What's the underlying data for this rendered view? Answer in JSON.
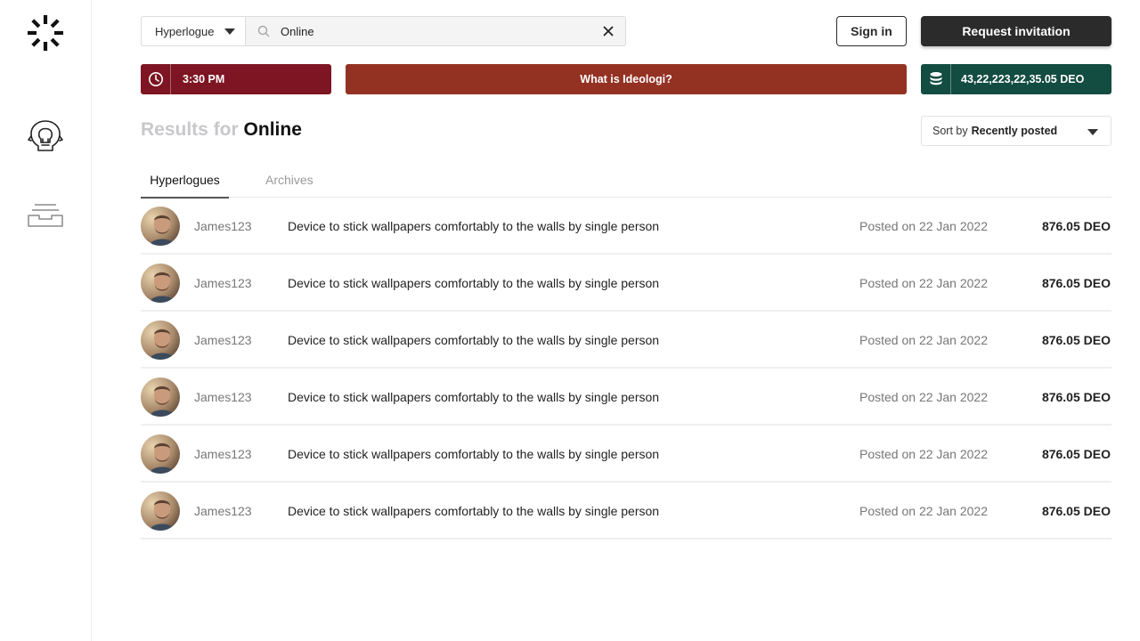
{
  "sidebar": {
    "logo_icon": "sunburst-logo-icon",
    "items": [
      {
        "name": "ideas",
        "icon": "lightbulb-head-icon"
      },
      {
        "name": "inbox",
        "icon": "inbox-tray-icon"
      }
    ]
  },
  "search": {
    "scope_label": "Hyperlogue",
    "value": "Online",
    "placeholder": ""
  },
  "header": {
    "signin_label": "Sign in",
    "invite_label": "Request invitation"
  },
  "info_bars": {
    "time": "3:30 PM",
    "about": "What is Ideologi?",
    "balance": "43,22,223,22,35.05 DEO",
    "colors": {
      "time": "#7d1522",
      "about": "#933223",
      "balance": "#134c41"
    }
  },
  "results": {
    "prefix": "Results for",
    "term": "Online",
    "sort_prefix": "Sort by",
    "sort_value": "Recently posted"
  },
  "tabs": [
    {
      "label": "Hyperlogues",
      "active": true
    },
    {
      "label": "Archives",
      "active": false
    }
  ],
  "rows": [
    {
      "user": "James123",
      "title": "Device to stick wallpapers comfortably to the walls by single person",
      "posted": "Posted on 22 Jan 2022",
      "amount": "876.05 DEO"
    },
    {
      "user": "James123",
      "title": "Device to stick wallpapers comfortably to the walls by single person",
      "posted": "Posted on 22 Jan 2022",
      "amount": "876.05 DEO"
    },
    {
      "user": "James123",
      "title": "Device to stick wallpapers comfortably to the walls by single person",
      "posted": "Posted on 22 Jan 2022",
      "amount": "876.05 DEO"
    },
    {
      "user": "James123",
      "title": "Device to stick wallpapers comfortably to the walls by single person",
      "posted": "Posted on 22 Jan 2022",
      "amount": "876.05 DEO"
    },
    {
      "user": "James123",
      "title": "Device to stick wallpapers comfortably to the walls by single person",
      "posted": "Posted on 22 Jan 2022",
      "amount": "876.05 DEO"
    },
    {
      "user": "James123",
      "title": "Device to stick wallpapers comfortably to the walls by single person",
      "posted": "Posted on 22 Jan 2022",
      "amount": "876.05 DEO"
    }
  ]
}
